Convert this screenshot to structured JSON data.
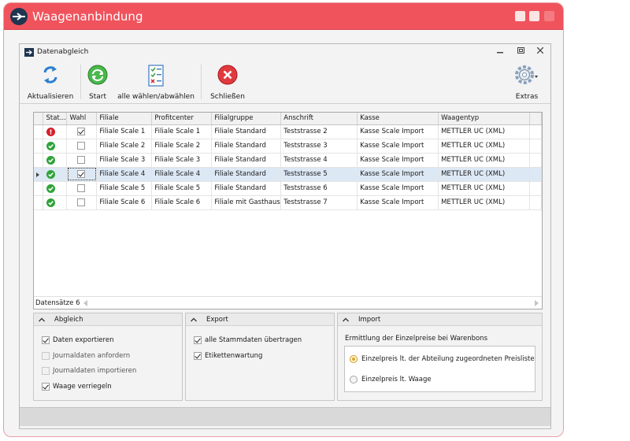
{
  "app": {
    "title": "Waagenanbindung"
  },
  "window": {
    "title": "Datenabgleich"
  },
  "toolbar": {
    "refresh_label": "Aktualisieren",
    "start_label": "Start",
    "select_all_label": "alle wählen/abwählen",
    "close_label": "Schließen",
    "extras_label": "Extras"
  },
  "grid": {
    "columns": [
      "Stat...",
      "Wahl",
      "Filiale",
      "Profitcenter",
      "Filialgruppe",
      "Anschrift",
      "Kasse",
      "Waagentyp"
    ],
    "rows": [
      {
        "status": "error",
        "wahl": true,
        "filiale": "Filiale Scale 1",
        "profitcenter": "Filiale Scale 1",
        "filialgruppe": "Filiale Standard",
        "anschrift": "Teststrasse 2",
        "kasse": "Kasse Scale Import",
        "waagentyp": "METTLER UC (XML)"
      },
      {
        "status": "ok",
        "wahl": false,
        "filiale": "Filiale Scale 2",
        "profitcenter": "Filiale Scale 2",
        "filialgruppe": "Filiale Standard",
        "anschrift": "Teststrasse 3",
        "kasse": "Kasse Scale Import",
        "waagentyp": "METTLER UC (XML)"
      },
      {
        "status": "ok",
        "wahl": false,
        "filiale": "Filiale Scale 3",
        "profitcenter": "Filiale Scale 3",
        "filialgruppe": "Filiale Standard",
        "anschrift": "Teststrasse 4",
        "kasse": "Kasse Scale Import",
        "waagentyp": "METTLER UC (XML)"
      },
      {
        "status": "ok",
        "wahl": true,
        "filiale": "Filiale Scale 4",
        "profitcenter": "Filiale Scale 4",
        "filialgruppe": "Filiale Standard",
        "anschrift": "Teststrasse 5",
        "kasse": "Kasse Scale Import",
        "waagentyp": "METTLER UC (XML)",
        "selected": true
      },
      {
        "status": "ok",
        "wahl": false,
        "filiale": "Filiale Scale 5",
        "profitcenter": "Filiale Scale 5",
        "filialgruppe": "Filiale Standard",
        "anschrift": "Teststrasse 6",
        "kasse": "Kasse Scale Import",
        "waagentyp": "METTLER UC (XML)"
      },
      {
        "status": "ok",
        "wahl": false,
        "filiale": "Filiale Scale 6",
        "profitcenter": "Filiale Scale 6",
        "filialgruppe": "Filiale mit Gasthaus",
        "anschrift": "Teststrasse 7",
        "kasse": "Kasse Scale Import",
        "waagentyp": "METTLER UC (XML)"
      }
    ],
    "record_count": "Datensätze 6"
  },
  "abgleich": {
    "title": "Abgleich",
    "options": [
      {
        "label": "Daten exportieren",
        "checked": true,
        "disabled": false
      },
      {
        "label": "Journaldaten anfordern",
        "checked": false,
        "disabled": true
      },
      {
        "label": "Journaldaten importieren",
        "checked": false,
        "disabled": true
      },
      {
        "label": "Waage verriegeln",
        "checked": true,
        "disabled": false
      }
    ]
  },
  "export": {
    "title": "Export",
    "options": [
      {
        "label": "alle Stammdaten übertragen",
        "checked": true
      },
      {
        "label": "Etikettenwartung",
        "checked": true
      }
    ]
  },
  "import": {
    "title": "Import",
    "caption": "Ermittlung der Einzelpreise bei Warenbons",
    "radios": [
      {
        "label": "Einzelpreis lt. der Abteilung zugeordneten Preisliste",
        "checked": true
      },
      {
        "label": "Einzelpreis lt. Waage",
        "checked": false
      }
    ]
  },
  "colors": {
    "title_bar": "#f0535c",
    "logo": "#1f3550",
    "selection": "#dde8f5",
    "ok": "#2fa33a",
    "error": "#d4202a"
  }
}
